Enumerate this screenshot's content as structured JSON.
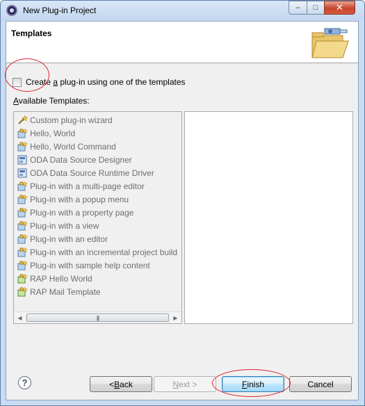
{
  "window": {
    "title": "New Plug-in Project"
  },
  "window_controls": {
    "minimize": "–",
    "maximize": "□",
    "close": "✕"
  },
  "header": {
    "title": "Templates",
    "art_icon": "folder-plugin-icon"
  },
  "checkbox": {
    "label_prefix": "Create ",
    "label_mnemonic": "a",
    "label_suffix": " plug-in using one of the templates",
    "checked": false
  },
  "available": {
    "label_mnemonic": "A",
    "label_rest": "vailable Templates:"
  },
  "templates": [
    {
      "label": "Custom plug-in wizard",
      "icon": "wand-icon"
    },
    {
      "label": "Hello, World",
      "icon": "plugin-template-icon"
    },
    {
      "label": "Hello, World Command",
      "icon": "plugin-template-icon"
    },
    {
      "label": "ODA Data Source Designer",
      "icon": "oda-icon"
    },
    {
      "label": "ODA Data Source Runtime Driver",
      "icon": "oda-icon"
    },
    {
      "label": "Plug-in with a multi-page editor",
      "icon": "plugin-template-icon"
    },
    {
      "label": "Plug-in with a popup menu",
      "icon": "plugin-template-icon"
    },
    {
      "label": "Plug-in with a property page",
      "icon": "plugin-template-icon"
    },
    {
      "label": "Plug-in with a view",
      "icon": "plugin-template-icon"
    },
    {
      "label": "Plug-in with an editor",
      "icon": "plugin-template-icon"
    },
    {
      "label": "Plug-in with an incremental project build",
      "icon": "plugin-template-icon"
    },
    {
      "label": "Plug-in with sample help content",
      "icon": "plugin-template-icon"
    },
    {
      "label": "RAP Hello World",
      "icon": "rap-icon"
    },
    {
      "label": "RAP Mail Template",
      "icon": "rap-icon"
    }
  ],
  "buttons": {
    "back_mn": "B",
    "back_rest": "ack",
    "back_prefix": "< ",
    "next_mn": "N",
    "next_rest": "ext >",
    "finish_mn": "F",
    "finish_rest": "inish",
    "cancel": "Cancel",
    "help": "?"
  }
}
